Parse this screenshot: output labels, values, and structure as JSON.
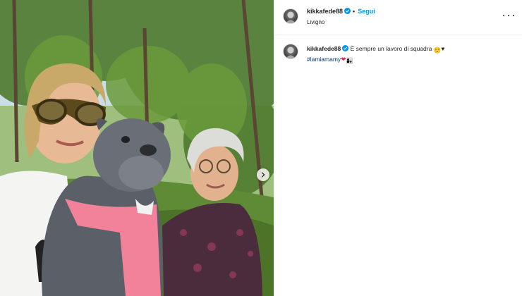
{
  "post": {
    "username": "kikkafede88",
    "separator": "•",
    "follow_label": "Segui",
    "location": "Livigno"
  },
  "caption": {
    "username": "kikkafede88",
    "text": "È sempre un lavoro di squadra",
    "emoji_1": "😌",
    "heart_1": "♥",
    "hashtag": "#lamiamamy",
    "heart_2": "❤",
    "emoji_2": "👩‍👧"
  },
  "icons": {
    "verified": "verified-badge-icon",
    "more": "more-options-icon",
    "next": "chevron-right-icon"
  },
  "colors": {
    "link_blue": "#0095f6",
    "verified_blue": "#0095f6",
    "hashtag_blue": "#00376b",
    "text": "#262626"
  }
}
